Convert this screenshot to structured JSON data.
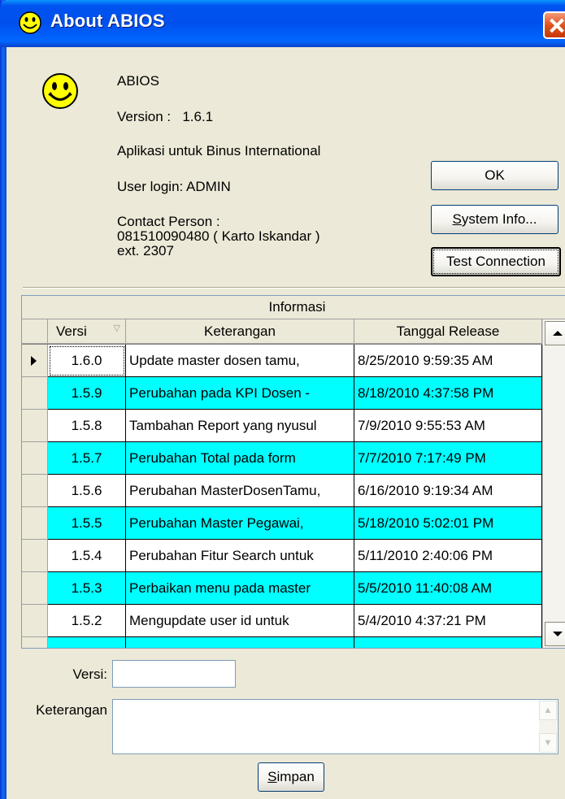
{
  "window": {
    "title": "About ABIOS",
    "icon": "smiley-face-icon",
    "close_icon": "close-icon"
  },
  "about": {
    "app_name": "ABIOS",
    "version": "Version :   1.6.1",
    "description": "Aplikasi untuk Binus International",
    "user_login": "User login: ADMIN",
    "contact_line1": "Contact Person :",
    "contact_line2": "081510090480 ( Karto Iskandar )",
    "contact_line3": "ext. 2307"
  },
  "buttons": {
    "ok": "OK",
    "system_info_prefix": "",
    "system_info_ul": "S",
    "system_info_rest": "ystem Info...",
    "test_connection": "Test Connection",
    "save_ul": "S",
    "save_rest": "impan"
  },
  "grid": {
    "caption": "Informasi",
    "columns": [
      "Versi",
      "Keterangan",
      "Tanggal Release"
    ],
    "rows": [
      {
        "versi": "1.6.0",
        "keterangan": "Update master dosen tamu,",
        "tanggal": "8/25/2010 9:59:35 AM",
        "highlight": false,
        "current": true
      },
      {
        "versi": "1.5.9",
        "keterangan": "Perubahan pada KPI Dosen -",
        "tanggal": "8/18/2010 4:37:58 PM",
        "highlight": true,
        "current": false
      },
      {
        "versi": "1.5.8",
        "keterangan": "Tambahan Report yang nyusul",
        "tanggal": "7/9/2010 9:55:53 AM",
        "highlight": false,
        "current": false
      },
      {
        "versi": "1.5.7",
        "keterangan": "Perubahan Total pada form",
        "tanggal": "7/7/2010 7:17:49 PM",
        "highlight": true,
        "current": false
      },
      {
        "versi": "1.5.6",
        "keterangan": "Perubahan MasterDosenTamu,",
        "tanggal": "6/16/2010 9:19:34 AM",
        "highlight": false,
        "current": false
      },
      {
        "versi": "1.5.5",
        "keterangan": "Perubahan Master Pegawai,",
        "tanggal": "5/18/2010 5:02:01 PM",
        "highlight": true,
        "current": false
      },
      {
        "versi": "1.5.4",
        "keterangan": "Perubahan Fitur Search untuk",
        "tanggal": "5/11/2010 2:40:06 PM",
        "highlight": false,
        "current": false
      },
      {
        "versi": "1.5.3",
        "keterangan": "Perbaikan menu pada master",
        "tanggal": "5/5/2010 11:40:08 AM",
        "highlight": true,
        "current": false
      },
      {
        "versi": "1.5.2",
        "keterangan": "Mengupdate user id untuk",
        "tanggal": "5/4/2010 4:37:21 PM",
        "highlight": false,
        "current": false
      },
      {
        "versi": "",
        "keterangan": "",
        "tanggal": "",
        "highlight": true,
        "current": false
      }
    ]
  },
  "form": {
    "versi_label": "Versi:",
    "versi_value": "",
    "keterangan_label": "Keterangan",
    "keterangan_value": ""
  },
  "colors": {
    "highlight_row": "#00ffff",
    "normal_row": "#ffffff",
    "title_bar": "#0054e3"
  }
}
